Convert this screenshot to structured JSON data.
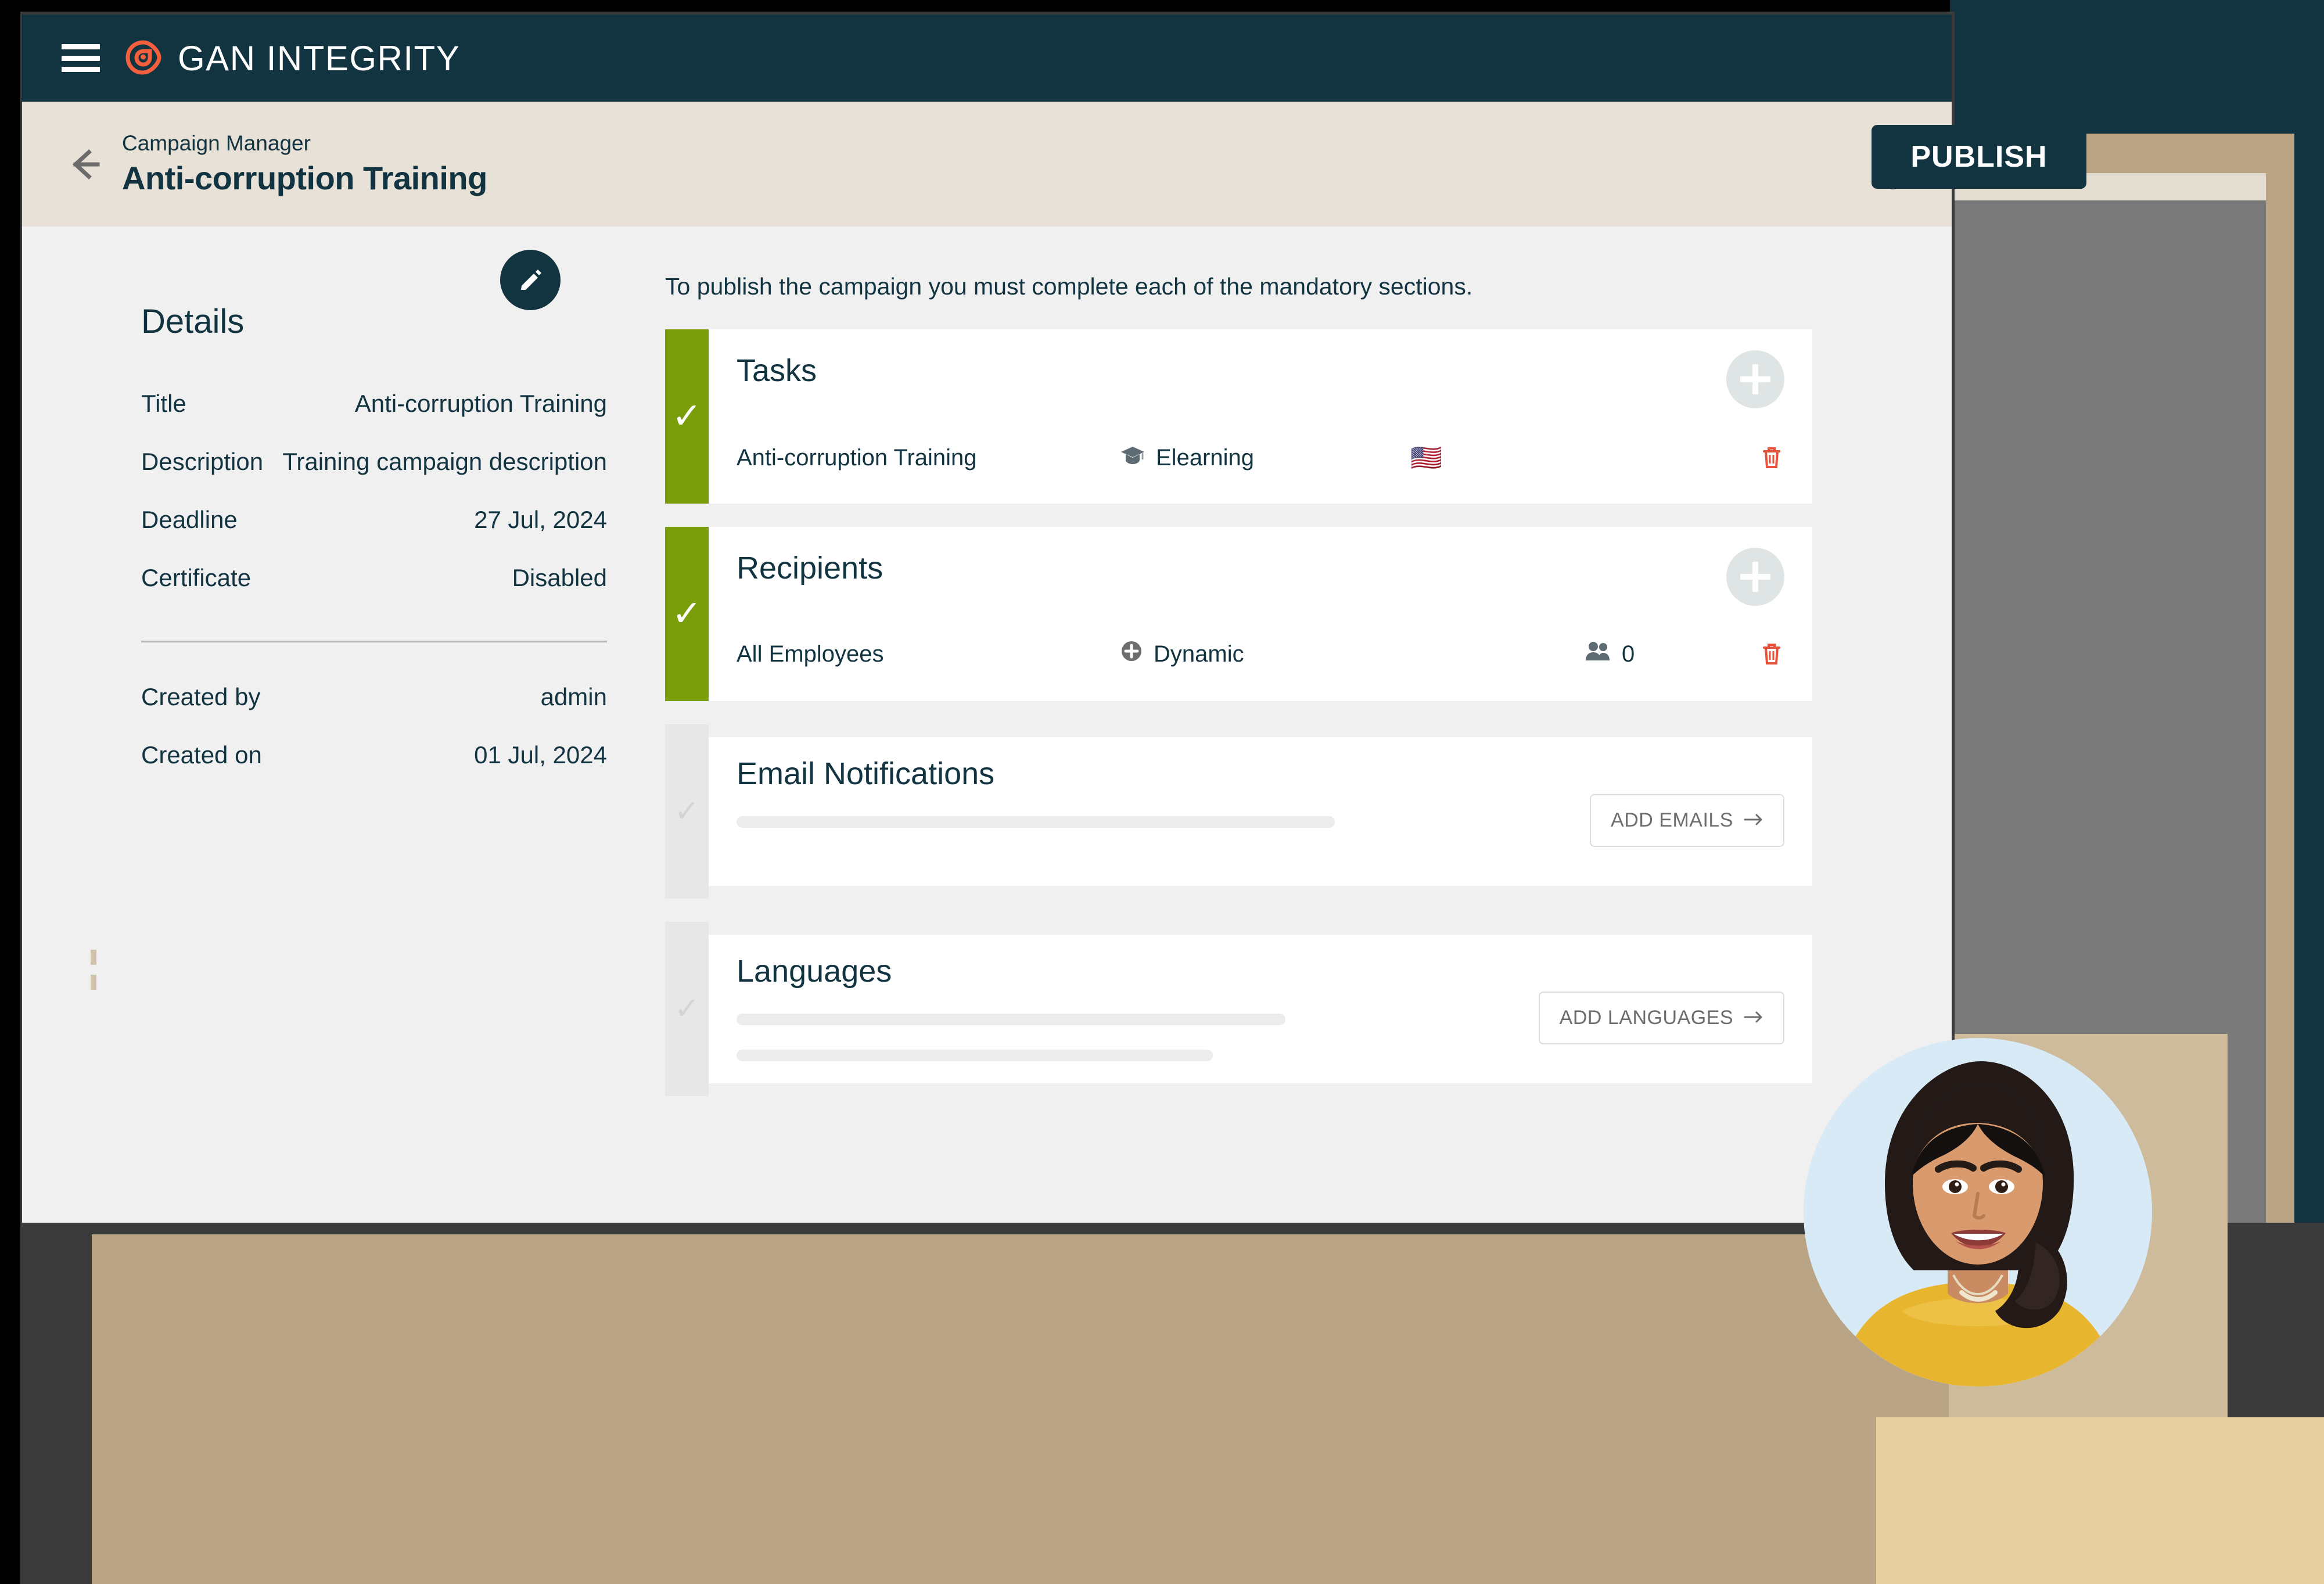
{
  "colors": {
    "brand_teal": "#123340",
    "brand_orange": "#f4603e",
    "header_cream": "#e7e1d7",
    "complete_green": "#7a9e09",
    "delete_red": "#e8513a",
    "page_bg": "#f0f0f0",
    "deco_tan": "#b9a585",
    "deco_gray": "#7a7a7a"
  },
  "topbar": {
    "menu_icon": "hamburger-menu-icon",
    "logo_icon": "gan-integrity-logo-icon",
    "brand_name": "GAN INTEGRITY"
  },
  "page_header": {
    "back_icon": "back-arrow-icon",
    "breadcrumb": "Campaign Manager",
    "title": "Anti-corruption Training",
    "overflow_icon": "kebab-menu-icon",
    "publish_label": "PUBLISH"
  },
  "details": {
    "heading": "Details",
    "edit_icon": "pencil-edit-icon",
    "rows": [
      {
        "label": "Title",
        "value": "Anti-corruption Training"
      },
      {
        "label": "Description",
        "value": "Training campaign description"
      },
      {
        "label": "Deadline",
        "value": "27 Jul, 2024"
      },
      {
        "label": "Certificate",
        "value": "Disabled"
      }
    ],
    "meta_rows": [
      {
        "label": "Created by",
        "value": "admin"
      },
      {
        "label": "Created on",
        "value": "01 Jul, 2024"
      }
    ]
  },
  "publish_panel": {
    "instruction": "To publish the campaign you must complete each of the mandatory sections.",
    "sections": [
      {
        "title": "Tasks",
        "complete": true,
        "check_icon": "check-icon",
        "add_icon": "plus-circle-icon",
        "item": {
          "name": "Anti-corruption Training",
          "type_icon": "graduation-cap-icon",
          "type": "Elearning",
          "flag": "🇺🇸",
          "delete_icon": "trash-icon"
        }
      },
      {
        "title": "Recipients",
        "complete": true,
        "check_icon": "check-icon",
        "add_icon": "plus-circle-icon",
        "item": {
          "name": "All Employees",
          "type_icon": "plus-circle-filled-icon",
          "type": "Dynamic",
          "count_icon": "people-icon",
          "count": "0",
          "delete_icon": "trash-icon"
        }
      },
      {
        "title": "Email Notifications",
        "complete": false,
        "check_icon": "check-icon",
        "action_label": "ADD EMAILS",
        "action_icon": "arrow-right-icon",
        "placeholder_lines": 1
      },
      {
        "title": "Languages",
        "complete": false,
        "check_icon": "check-icon",
        "action_label": "ADD LANGUAGES",
        "action_icon": "arrow-right-icon",
        "placeholder_lines": 2
      }
    ]
  },
  "decoration": {
    "portrait_alt": "smiling-woman-portrait"
  }
}
